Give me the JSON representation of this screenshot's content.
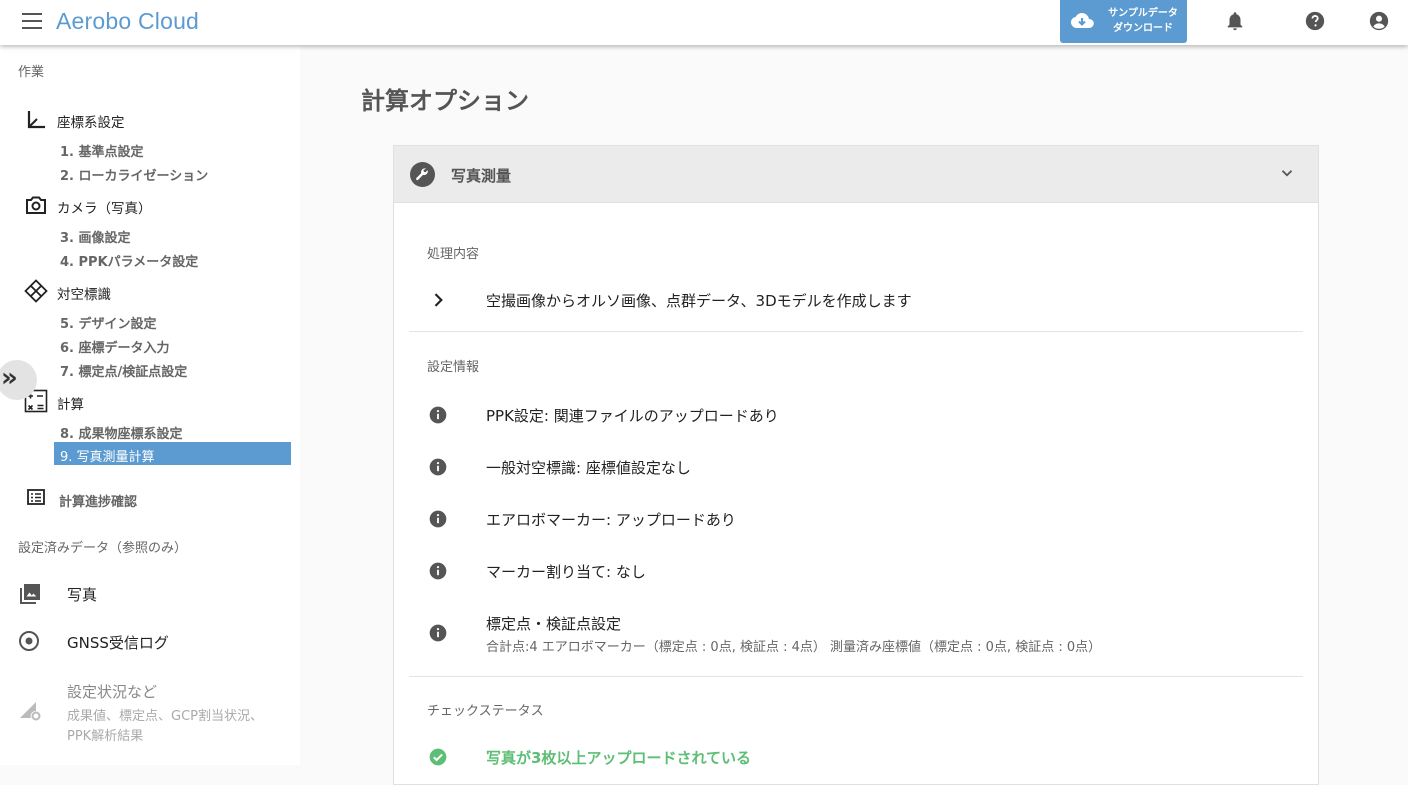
{
  "app": {
    "title": "Aerobo Cloud",
    "download_label_1": "サンプルデータ",
    "download_label_2": "ダウンロード"
  },
  "sidebar": {
    "section_work": "作業",
    "groups": [
      {
        "icon": "axis-icon",
        "label": "座標系設定",
        "items": [
          "1. 基準点設定",
          "2. ローカライゼーション"
        ]
      },
      {
        "icon": "camera-icon",
        "label": "カメラ（写真）",
        "items": [
          "3. 画像設定",
          "4. PPKパラメータ設定"
        ]
      },
      {
        "icon": "diamond-target-icon",
        "label": "対空標識",
        "items": [
          "5. デザイン設定",
          "6. 座標データ入力",
          "7. 標定点/検証点設定"
        ]
      },
      {
        "icon": "calculator-icon",
        "label": "計算",
        "items": [
          "8. 成果物座標系設定",
          "9. 写真測量計算"
        ]
      }
    ],
    "active_item": "9. 写真測量計算",
    "progress_label": "計算進捗確認",
    "section_ref": "設定済みデータ（参照のみ）",
    "ref_items": [
      {
        "icon": "photo-icon",
        "label": "写真"
      },
      {
        "icon": "gnss-icon",
        "label": "GNSS受信ログ"
      },
      {
        "icon": "settings-signal-icon",
        "label": "設定状況など",
        "desc_1": "成果値、標定点、GCP割当状況、",
        "desc_2": "PPK解析結果"
      }
    ]
  },
  "main": {
    "page_title": "計算オプション",
    "panel_title": "写真測量",
    "processing_label": "処理内容",
    "processing_text": "空撮画像からオルソ画像、点群データ、3Dモデルを作成します",
    "settings_label": "設定情報",
    "settings_rows": [
      {
        "text": "PPK設定: 関連ファイルのアップロードあり"
      },
      {
        "text": "一般対空標識: 座標値設定なし"
      },
      {
        "text": "エアロボマーカー: アップロードあり"
      },
      {
        "text": "マーカー割り当て: なし"
      },
      {
        "text": "標定点・検証点設定",
        "sub": "合計点:4 エアロボマーカー（標定点 : 0点, 検証点 : 4点） 測量済み座標値（標定点 : 0点, 検証点 : 0点）"
      }
    ],
    "check_label": "チェックステータス",
    "check_rows": [
      {
        "text": "写真が3枚以上アップロードされている",
        "status": "ok"
      }
    ]
  },
  "colors": {
    "brand": "#5b9bd1",
    "ok": "#5dbe75",
    "active_bg": "#5b9bd1"
  }
}
